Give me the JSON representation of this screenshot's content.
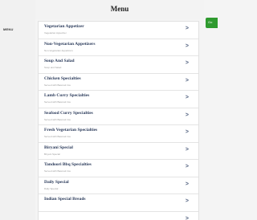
{
  "header": {
    "title": "Menu",
    "side_label": "MENU",
    "action_label": "Go"
  },
  "menu": {
    "items": [
      {
        "name": "Vegetarian Appetizer",
        "sub": "Vegetarian Appetizer",
        "chevron": ">"
      },
      {
        "name": "Non-Vegetarian Appetizers",
        "sub": "Non-Vegetarian Appetizers",
        "chevron": ">"
      },
      {
        "name": "Soup And Salad",
        "sub": "Soup and Salad",
        "chevron": ">"
      },
      {
        "name": "Chicken Specialties",
        "sub": "Served with Basmati rice",
        "chevron": ">"
      },
      {
        "name": "Lamb Curry Specialties",
        "sub": "Served with Basmati rice",
        "chevron": ">"
      },
      {
        "name": "Seafood Curry Specialties",
        "sub": "Served with Basmati rice",
        "chevron": ">"
      },
      {
        "name": "Fresh Vegetarian Specialties",
        "sub": "Served with Basmati rice",
        "chevron": ">"
      },
      {
        "name": "Biryani Special",
        "sub": "Biryani Special",
        "chevron": ">"
      },
      {
        "name": "Tandoori Bbq Specialties",
        "sub": "Served with Basmati rice",
        "chevron": ">"
      },
      {
        "name": "Daily Special",
        "sub": "Daily Special",
        "chevron": ">"
      },
      {
        "name": "Indian Special Breads",
        "sub": "",
        "chevron": ">"
      },
      {
        "name": "",
        "sub": "",
        "chevron": ">"
      }
    ]
  },
  "colors": {
    "accent_green": "#2f9a2f",
    "item_text": "#2a3a5a"
  }
}
